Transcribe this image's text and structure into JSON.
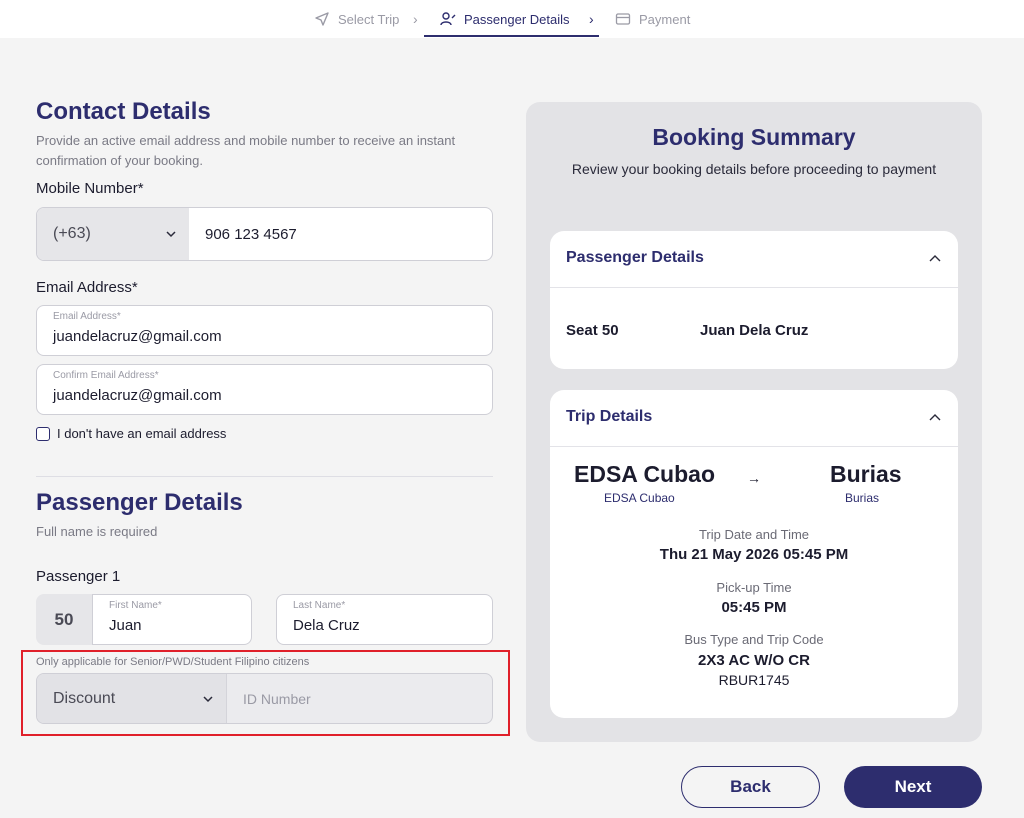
{
  "stepper": {
    "steps": [
      {
        "label": "Select Trip",
        "icon": "send-icon"
      },
      {
        "label": "Passenger Details",
        "icon": "user-pin-icon"
      },
      {
        "label": "Payment",
        "icon": "card-icon"
      }
    ],
    "active_index": 1
  },
  "contact": {
    "title": "Contact Details",
    "description": "Provide an active email address and mobile number to receive an instant confirmation of your booking.",
    "mobile_label": "Mobile Number*",
    "country_code": "(+63)",
    "mobile_value": "906 123 4567",
    "email_label": "Email Address*",
    "email_field_label": "Email Address*",
    "email_value": "juandelacruz@gmail.com",
    "confirm_email_label": "Confirm Email Address*",
    "confirm_email_value": "juandelacruz@gmail.com",
    "no_email_label": "I don't have an email address"
  },
  "passenger": {
    "title": "Passenger Details",
    "description": "Full name is required",
    "passenger_label": "Passenger 1",
    "seat": "50",
    "first_name_label": "First Name*",
    "first_name_value": "Juan",
    "last_name_label": "Last Name*",
    "last_name_value": "Dela Cruz",
    "discount_hint": "Only applicable for Senior/PWD/Student Filipino citizens",
    "discount_selected": "Discount",
    "id_placeholder": "ID Number"
  },
  "summary": {
    "title": "Booking Summary",
    "subtitle": "Review your booking details before proceeding to payment",
    "passenger_card": {
      "title": "Passenger Details",
      "seat_text": "Seat 50",
      "name": "Juan Dela Cruz"
    },
    "trip_card": {
      "title": "Trip Details",
      "origin": "EDSA Cubao",
      "origin_sub": "EDSA Cubao",
      "arrow": "→",
      "destination": "Burias",
      "destination_sub": "Burias",
      "date_label": "Trip Date and Time",
      "date_value": "Thu 21 May 2026 05:45 PM",
      "pickup_label": "Pick-up Time",
      "pickup_value": "05:45 PM",
      "bus_label": "Bus Type and Trip Code",
      "bus_type": "2X3 AC W/O CR",
      "trip_code": "RBUR1745"
    }
  },
  "actions": {
    "back": "Back",
    "next": "Next"
  },
  "colors": {
    "primary": "#2d2d6e",
    "highlight": "#e0202a"
  }
}
